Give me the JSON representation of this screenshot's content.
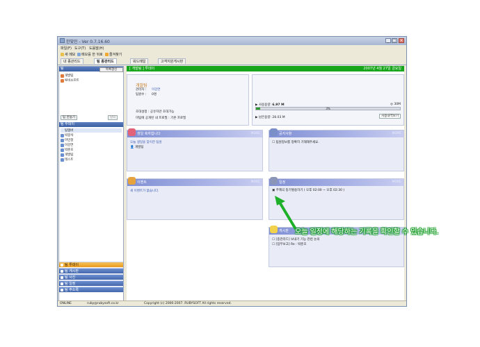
{
  "window": {
    "title": "한빛인 - Ver 0.7.16.60"
  },
  "menu": [
    "파일(F)",
    "도구(T)",
    "도움말(H)"
  ],
  "toolbar": {
    "new_memo": "새 메모",
    "memo_view": "메모를 한 뒤로",
    "favorites": "즐겨찾기"
  },
  "tabs": [
    {
      "label": "내 종관리드"
    },
    {
      "label": "팀 종관리드"
    },
    {
      "label": "워드메일"
    },
    {
      "label": "고객지원게시판"
    }
  ],
  "sidebar": {
    "team_header": "팀",
    "refresh_label": "목록갱신",
    "teams": [
      "개발팀",
      "루비소프트"
    ],
    "make_team_button": "팀 만들기",
    "exit_button": "탈퇴",
    "today_header": "팀 투데이",
    "members": [
      "팀멤버",
      "박봉석",
      "마민정",
      "이강연",
      "박준호",
      "개발팀",
      "테스트"
    ],
    "nav": [
      "팀 투데이",
      "팀 게시판",
      "팀 사진",
      "팀 일정",
      "팀 주소록"
    ]
  },
  "header": {
    "team_title": "[ 개발팀 ] 투데이",
    "date": "2007년 4월 27일 금요일"
  },
  "team_info": {
    "name": "개발팀",
    "leader_label": "관리자 :",
    "leader_value": "이강연",
    "members_label": "팀원수 :",
    "members_value": "0명",
    "invite_label": "초대설정 : 공유자만 초대가능",
    "public_label": "미팀에 공개된 내 프로필 : 기본 프로필"
  },
  "storage": {
    "used_label": "사용용량:",
    "used_value": "6.97 M",
    "total_value": "30M",
    "percent_text": "3%",
    "percent": 3,
    "remaining_label": "남은용량:",
    "remaining_value": "28.03 M",
    "history_button": "사용내역보기"
  },
  "panels": {
    "birthday": {
      "title": "생일 축하합니다",
      "more": "MORE",
      "line1": "오늘 생일을 맞이한 팀원",
      "line2": "개발팀"
    },
    "notice": {
      "title": "공지사항",
      "more": "MORE",
      "line1": "팀원정보를 정확히 기재해주세요."
    },
    "events": {
      "title": "이벤트",
      "more": "MORE",
      "line1": "새 이벤트가 없습니다."
    },
    "schedule": {
      "title": "일정",
      "more": "MORE",
      "line1": "주제곡 등기벌송하기 ( 오후 02:00 ~ 오후 02:30 )"
    },
    "board": {
      "title": "게시판",
      "more": "MORE",
      "line1": "[종관리드] 보내기 기능 관련 논의",
      "line2": "[업무보고] Re : 박준호"
    }
  },
  "status": {
    "online": "ONLINE",
    "email": "ruby@rubysoft.co.kr",
    "copyright": "Copyright (c) 2006-2007. RUBYSOFT All rights reserved."
  },
  "callout": {
    "text": "오늘 일정에 해당하는 기록을 확인할 수 있습니다."
  },
  "colors": {
    "accent_green": "#16a51b",
    "nav_blue": "#4568ad",
    "nav_active": "#e89a1f",
    "panel_bg": "#e9ecf7"
  }
}
